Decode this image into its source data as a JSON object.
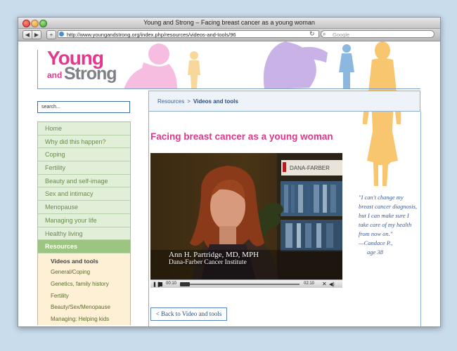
{
  "window": {
    "title": "Young and Strong – Facing breast cancer as a young woman"
  },
  "browser": {
    "back": "◀",
    "forward": "▶",
    "add": "+",
    "url": "http://www.youngandstrong.org/index.php/resources/videos-and-tools/96",
    "reload": "↻",
    "search_placeholder": "Google"
  },
  "site": {
    "logo_young": "Young",
    "logo_and": "and",
    "logo_strong": "Strong",
    "search_value": "search..."
  },
  "nav": {
    "items": [
      {
        "label": "Home"
      },
      {
        "label": "Why did this happen?"
      },
      {
        "label": "Coping"
      },
      {
        "label": "Fertility"
      },
      {
        "label": "Beauty and self-image"
      },
      {
        "label": "Sex and intimacy"
      },
      {
        "label": "Menopause"
      },
      {
        "label": "Managing your life"
      },
      {
        "label": "Healthy living"
      },
      {
        "label": "Resources"
      }
    ],
    "subitems": [
      {
        "label": "Videos and tools"
      },
      {
        "label": "General/Coping"
      },
      {
        "label": "Genetics, family history"
      },
      {
        "label": "Fertility"
      },
      {
        "label": "Beauty/Sex/Menopause"
      },
      {
        "label": "Managing: Helping kids"
      }
    ]
  },
  "breadcrumb": {
    "parent": "Resources",
    "separator": ">",
    "current": "Videos and tools"
  },
  "main": {
    "heading": "Facing breast cancer as a young woman",
    "video_caption_name": "Ann H. Partridge, MD, MPH",
    "video_caption_org": "Dana-Farber Cancer Institute",
    "video_sign": "DANA-FARBER",
    "time_elapsed": "00:10",
    "time_total": "02:10",
    "back_link": "< Back to Video and tools"
  },
  "quote": {
    "text": "\"I can't change my breast cancer diagnosis, but I can make sure I take care of my health from now on.\"",
    "attribution": "—Candace P.,",
    "age": "age 38"
  },
  "colors": {
    "brand_pink": "#e6378f",
    "nav_green": "#9bc581",
    "link_blue": "#2a4f80",
    "silhouette_orange": "#f8c66e",
    "silhouette_purple": "#c9b2e6",
    "silhouette_pink": "#f6bde0"
  }
}
